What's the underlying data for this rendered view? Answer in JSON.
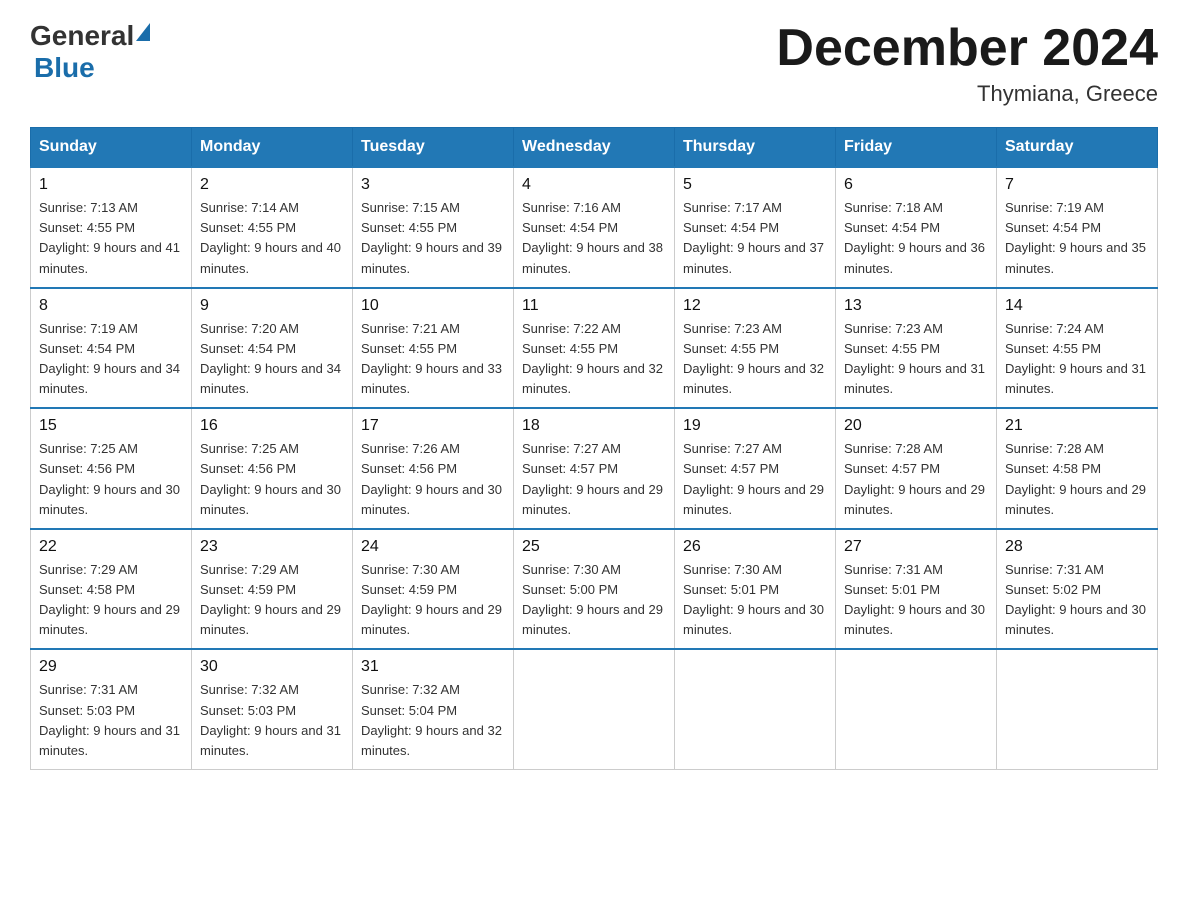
{
  "header": {
    "logo_general": "General",
    "logo_blue": "Blue",
    "month_title": "December 2024",
    "location": "Thymiana, Greece"
  },
  "days_of_week": [
    "Sunday",
    "Monday",
    "Tuesday",
    "Wednesday",
    "Thursday",
    "Friday",
    "Saturday"
  ],
  "weeks": [
    [
      {
        "day": "1",
        "sunrise": "7:13 AM",
        "sunset": "4:55 PM",
        "daylight": "9 hours and 41 minutes."
      },
      {
        "day": "2",
        "sunrise": "7:14 AM",
        "sunset": "4:55 PM",
        "daylight": "9 hours and 40 minutes."
      },
      {
        "day": "3",
        "sunrise": "7:15 AM",
        "sunset": "4:55 PM",
        "daylight": "9 hours and 39 minutes."
      },
      {
        "day": "4",
        "sunrise": "7:16 AM",
        "sunset": "4:54 PM",
        "daylight": "9 hours and 38 minutes."
      },
      {
        "day": "5",
        "sunrise": "7:17 AM",
        "sunset": "4:54 PM",
        "daylight": "9 hours and 37 minutes."
      },
      {
        "day": "6",
        "sunrise": "7:18 AM",
        "sunset": "4:54 PM",
        "daylight": "9 hours and 36 minutes."
      },
      {
        "day": "7",
        "sunrise": "7:19 AM",
        "sunset": "4:54 PM",
        "daylight": "9 hours and 35 minutes."
      }
    ],
    [
      {
        "day": "8",
        "sunrise": "7:19 AM",
        "sunset": "4:54 PM",
        "daylight": "9 hours and 34 minutes."
      },
      {
        "day": "9",
        "sunrise": "7:20 AM",
        "sunset": "4:54 PM",
        "daylight": "9 hours and 34 minutes."
      },
      {
        "day": "10",
        "sunrise": "7:21 AM",
        "sunset": "4:55 PM",
        "daylight": "9 hours and 33 minutes."
      },
      {
        "day": "11",
        "sunrise": "7:22 AM",
        "sunset": "4:55 PM",
        "daylight": "9 hours and 32 minutes."
      },
      {
        "day": "12",
        "sunrise": "7:23 AM",
        "sunset": "4:55 PM",
        "daylight": "9 hours and 32 minutes."
      },
      {
        "day": "13",
        "sunrise": "7:23 AM",
        "sunset": "4:55 PM",
        "daylight": "9 hours and 31 minutes."
      },
      {
        "day": "14",
        "sunrise": "7:24 AM",
        "sunset": "4:55 PM",
        "daylight": "9 hours and 31 minutes."
      }
    ],
    [
      {
        "day": "15",
        "sunrise": "7:25 AM",
        "sunset": "4:56 PM",
        "daylight": "9 hours and 30 minutes."
      },
      {
        "day": "16",
        "sunrise": "7:25 AM",
        "sunset": "4:56 PM",
        "daylight": "9 hours and 30 minutes."
      },
      {
        "day": "17",
        "sunrise": "7:26 AM",
        "sunset": "4:56 PM",
        "daylight": "9 hours and 30 minutes."
      },
      {
        "day": "18",
        "sunrise": "7:27 AM",
        "sunset": "4:57 PM",
        "daylight": "9 hours and 29 minutes."
      },
      {
        "day": "19",
        "sunrise": "7:27 AM",
        "sunset": "4:57 PM",
        "daylight": "9 hours and 29 minutes."
      },
      {
        "day": "20",
        "sunrise": "7:28 AM",
        "sunset": "4:57 PM",
        "daylight": "9 hours and 29 minutes."
      },
      {
        "day": "21",
        "sunrise": "7:28 AM",
        "sunset": "4:58 PM",
        "daylight": "9 hours and 29 minutes."
      }
    ],
    [
      {
        "day": "22",
        "sunrise": "7:29 AM",
        "sunset": "4:58 PM",
        "daylight": "9 hours and 29 minutes."
      },
      {
        "day": "23",
        "sunrise": "7:29 AM",
        "sunset": "4:59 PM",
        "daylight": "9 hours and 29 minutes."
      },
      {
        "day": "24",
        "sunrise": "7:30 AM",
        "sunset": "4:59 PM",
        "daylight": "9 hours and 29 minutes."
      },
      {
        "day": "25",
        "sunrise": "7:30 AM",
        "sunset": "5:00 PM",
        "daylight": "9 hours and 29 minutes."
      },
      {
        "day": "26",
        "sunrise": "7:30 AM",
        "sunset": "5:01 PM",
        "daylight": "9 hours and 30 minutes."
      },
      {
        "day": "27",
        "sunrise": "7:31 AM",
        "sunset": "5:01 PM",
        "daylight": "9 hours and 30 minutes."
      },
      {
        "day": "28",
        "sunrise": "7:31 AM",
        "sunset": "5:02 PM",
        "daylight": "9 hours and 30 minutes."
      }
    ],
    [
      {
        "day": "29",
        "sunrise": "7:31 AM",
        "sunset": "5:03 PM",
        "daylight": "9 hours and 31 minutes."
      },
      {
        "day": "30",
        "sunrise": "7:32 AM",
        "sunset": "5:03 PM",
        "daylight": "9 hours and 31 minutes."
      },
      {
        "day": "31",
        "sunrise": "7:32 AM",
        "sunset": "5:04 PM",
        "daylight": "9 hours and 32 minutes."
      },
      null,
      null,
      null,
      null
    ]
  ]
}
